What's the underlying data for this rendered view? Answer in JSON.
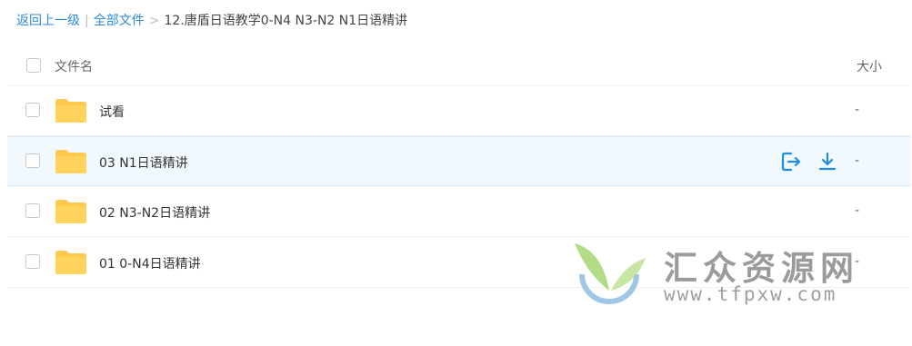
{
  "breadcrumb": {
    "back_link": "返回上一级",
    "separator1": "|",
    "all_files_link": "全部文件",
    "separator2": ">",
    "current": "12.唐盾日语教学0-N4 N3-N2 N1日语精讲"
  },
  "table": {
    "header": {
      "name_label": "文件名",
      "size_label": "大小"
    },
    "rows": [
      {
        "name": "试看",
        "size": "-",
        "icon": "folder-icon"
      },
      {
        "name": "03 N1日语精讲",
        "size": "-",
        "icon": "folder-icon",
        "hovered": true,
        "actions": [
          {
            "icon": "share-icon"
          },
          {
            "icon": "download-icon"
          }
        ]
      },
      {
        "name": "02 N3-N2日语精讲",
        "size": "-",
        "icon": "folder-icon"
      },
      {
        "name": "01 0-N4日语精讲",
        "size": "-",
        "icon": "folder-icon"
      }
    ]
  },
  "watermark": {
    "title": "汇众资源网",
    "url": "www.tfpxw.com"
  },
  "colors": {
    "link": "#2c8ad9",
    "folder": "#ffc94c",
    "action": "#1e8ee0",
    "hover_bg": "#f1f8fe"
  }
}
